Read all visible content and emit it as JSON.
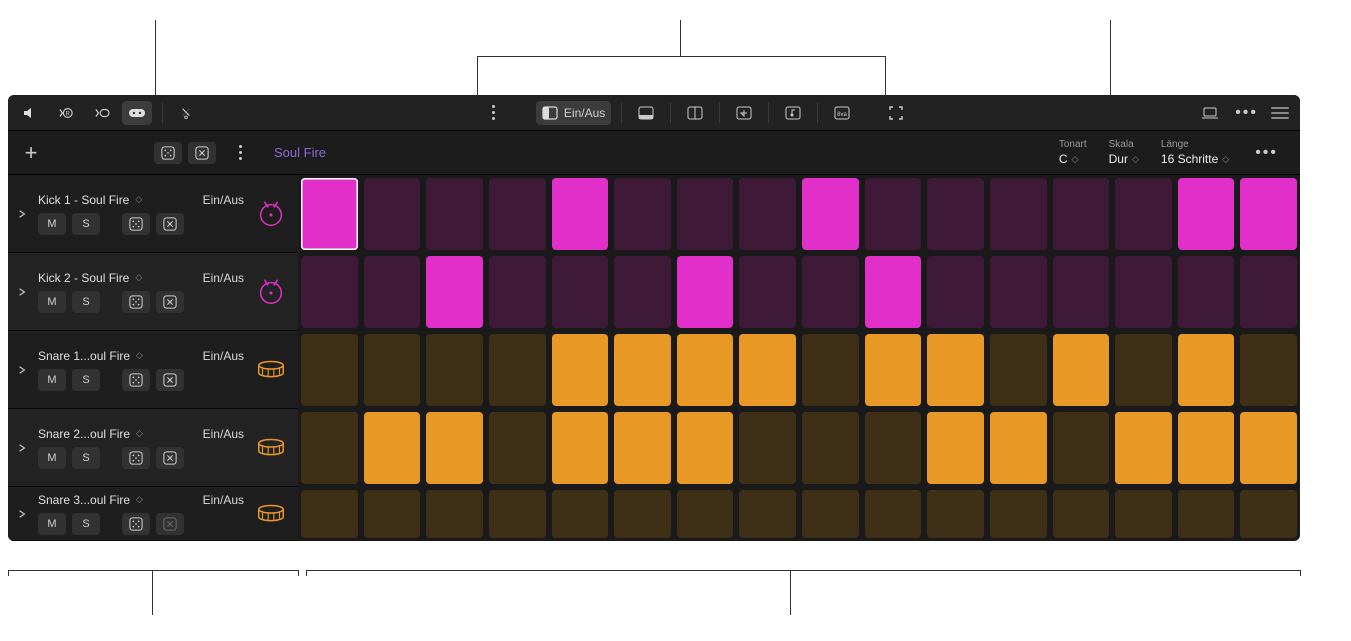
{
  "toolbar": {
    "on_off_label": "Ein/Aus"
  },
  "pattern": {
    "name": "Soul Fire"
  },
  "config": {
    "key_label": "Tonart",
    "key_value": "C",
    "scale_label": "Skala",
    "scale_value": "Dur",
    "length_label": "Länge",
    "length_value": "16 Schritte"
  },
  "buttons": {
    "mute": "M",
    "solo": "S"
  },
  "rows": [
    {
      "name": "Kick 1 - Soul Fire",
      "status": "Ein/Aus",
      "color": "magenta",
      "instrument": "kick",
      "selected_step": 0,
      "steps": [
        true,
        false,
        false,
        false,
        true,
        false,
        false,
        false,
        true,
        false,
        false,
        false,
        false,
        false,
        true,
        true
      ]
    },
    {
      "name": "Kick 2 - Soul Fire",
      "status": "Ein/Aus",
      "color": "magenta",
      "instrument": "kick",
      "steps": [
        false,
        false,
        true,
        false,
        false,
        false,
        true,
        false,
        false,
        true,
        false,
        false,
        false,
        false,
        false,
        false
      ]
    },
    {
      "name": "Snare 1...oul Fire",
      "status": "Ein/Aus",
      "color": "orange",
      "instrument": "snare",
      "steps": [
        false,
        false,
        false,
        false,
        true,
        true,
        true,
        true,
        false,
        true,
        true,
        false,
        true,
        false,
        true,
        false
      ]
    },
    {
      "name": "Snare 2...oul Fire",
      "status": "Ein/Aus",
      "color": "orange",
      "instrument": "snare",
      "steps": [
        false,
        true,
        true,
        false,
        true,
        true,
        true,
        false,
        false,
        false,
        true,
        true,
        false,
        true,
        true,
        true
      ]
    },
    {
      "name": "Snare 3...oul Fire",
      "status": "Ein/Aus",
      "color": "orange",
      "instrument": "snare",
      "short": true,
      "steps": [
        false,
        false,
        false,
        false,
        false,
        false,
        false,
        false,
        false,
        false,
        false,
        false,
        false,
        false,
        false,
        false
      ]
    }
  ]
}
